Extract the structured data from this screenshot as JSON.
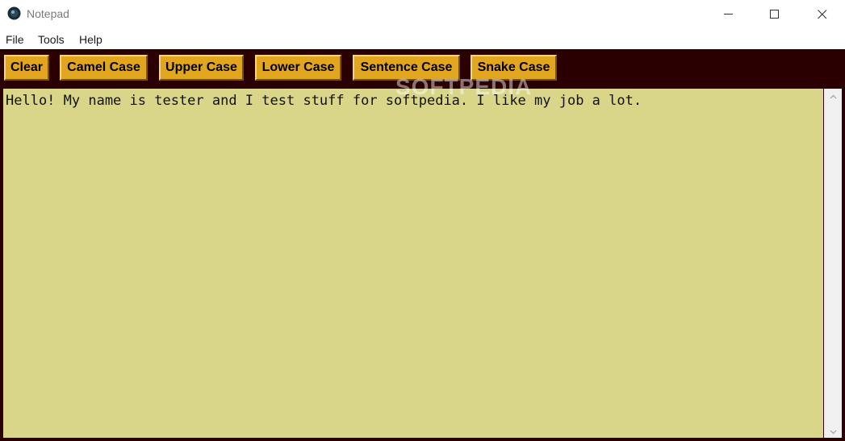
{
  "window": {
    "title": "Notepad",
    "controls": [
      "minimize",
      "maximize",
      "close"
    ]
  },
  "menu": {
    "items": [
      {
        "label": "File"
      },
      {
        "label": "Tools"
      },
      {
        "label": "Help"
      }
    ]
  },
  "toolbar": {
    "buttons": [
      {
        "label": "Clear"
      },
      {
        "label": "Camel Case"
      },
      {
        "label": "Upper Case"
      },
      {
        "label": "Lower Case"
      },
      {
        "label": "Sentence Case"
      },
      {
        "label": "Snake Case"
      }
    ]
  },
  "editor": {
    "text": "Hello! My name is tester and I test stuff for softpedia. I like my job a lot."
  },
  "watermark": {
    "text": "SOFTPEDIA"
  },
  "colors": {
    "toolbar_bg": "#2b0000",
    "button_bg": "#e2a51f",
    "editor_bg": "#d9d589"
  },
  "icons": {
    "app": "app-logo-icon",
    "minimize": "minimize-icon",
    "maximize": "maximize-icon",
    "close": "close-icon",
    "scroll_up": "chevron-up-icon",
    "scroll_down": "chevron-down-icon"
  }
}
